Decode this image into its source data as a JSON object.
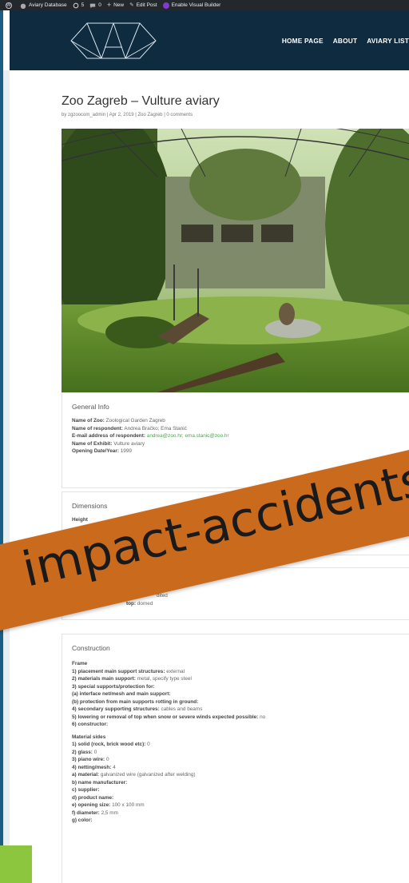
{
  "admin_bar": {
    "site_name": "Aviary Database",
    "updates_count": "5",
    "comments_count": "0",
    "new_label": "New",
    "edit_label": "Edit Post",
    "visual_builder_label": "Enable Visual Builder"
  },
  "nav": {
    "items": [
      "HOME PAGE",
      "ABOUT",
      "AVIARY LIST"
    ]
  },
  "post": {
    "title": "Zoo Zagreb – Vulture aviary",
    "meta": "by zgzoocom_admin | Apr 2, 2019 | Zoo Zagreb | 0 comments"
  },
  "general_info": {
    "heading": "General Info",
    "zoo_label": "Name of Zoo:",
    "zoo_value": "Zoological Garden Zagreb",
    "respondent_label": "Name of respondent:",
    "respondent_value": "Andrea Bračko; Ema Stanić",
    "email_label": "E-mail address of respondent:",
    "email_value": "andrea@zoo.hr; ema.stanic@zoo.hr",
    "exhibit_label": "Name of Exhibit:",
    "exhibit_value": "Vulture aviary",
    "opening_label": "Opening Date/Year:",
    "opening_value": "1999"
  },
  "dimensions": {
    "heading": "Dimensions",
    "height_label": "Height"
  },
  "shape": {
    "value_fragment": "dited",
    "top_label": "top:",
    "top_value": "domed"
  },
  "construction": {
    "heading": "Construction",
    "frame_heading": "Frame",
    "frame": [
      {
        "label": "1) placement main support structures:",
        "value": "external"
      },
      {
        "label": "2) materials main support:",
        "value": "metal, specify type steel"
      },
      {
        "label": "3) special supports/protection for:",
        "value": ""
      },
      {
        "label": "(a) interface net/mesh and main support:",
        "value": ""
      },
      {
        "label": "(b) protection from main supports rotting in ground:",
        "value": ""
      },
      {
        "label": "4) secondary supporting structures:",
        "value": "cables and beams"
      },
      {
        "label": "5) lowering or removal of top when snow or severe winds expected possible:",
        "value": "no"
      },
      {
        "label": "6) constructor:",
        "value": ""
      }
    ],
    "sides_heading": "Material sides",
    "sides": [
      {
        "label": "1) solid (rock, brick wood etc):",
        "value": "0"
      },
      {
        "label": "2) glass:",
        "value": "0"
      },
      {
        "label": "3) piano wire:",
        "value": "0"
      },
      {
        "label": "4) netting/mesh:",
        "value": "4"
      },
      {
        "label": "a) material:",
        "value": "galvanized wire (galvanized after welding)"
      },
      {
        "label": "b) name manufacturer:",
        "value": ""
      },
      {
        "label": "c) supplier:",
        "value": ""
      },
      {
        "label": "d) product name:",
        "value": ""
      },
      {
        "label": "e) opening size:",
        "value": "100 x 100 mm"
      },
      {
        "label": "f) diameter:",
        "value": "2,5 mm"
      },
      {
        "label": "g) color:",
        "value": ""
      }
    ]
  },
  "banner": {
    "text": "impact-accidents"
  },
  "colors": {
    "header_bg": "#0f2b40",
    "banner_bg": "#c96a1c",
    "link_green": "#4aa84a"
  }
}
